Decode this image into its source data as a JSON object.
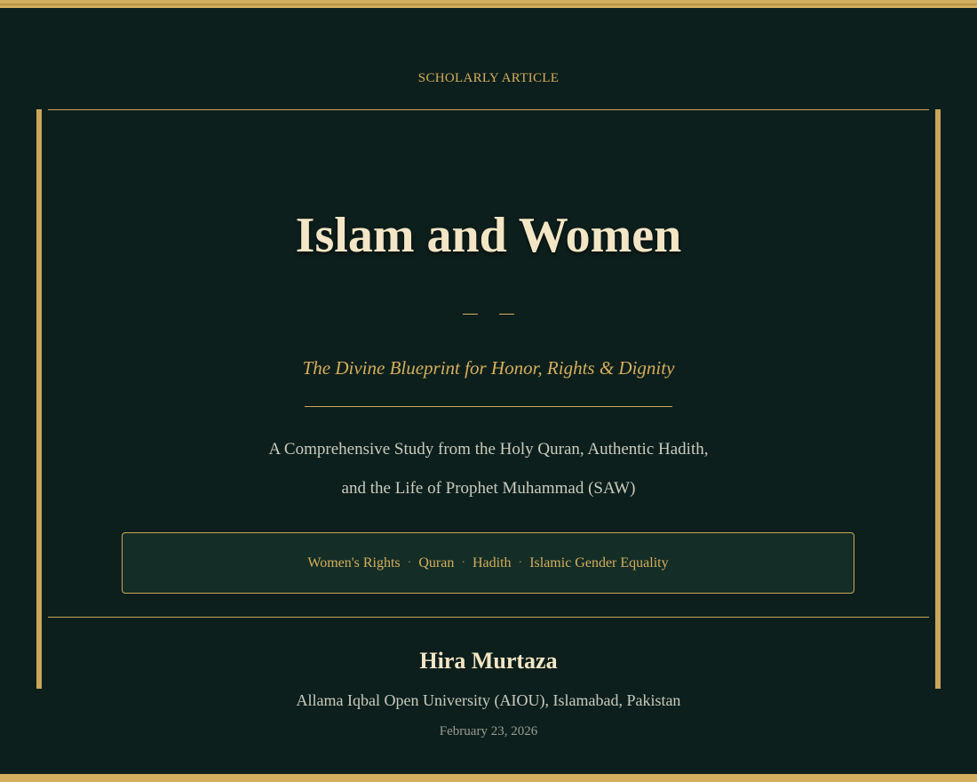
{
  "header": {
    "eyebrow": "SCHOLARLY ARTICLE"
  },
  "article": {
    "title": "Islam and Women",
    "ornament": "— —",
    "subtitle": "The Divine Blueprint for Honor, Rights & Dignity",
    "description_line1": "A Comprehensive Study from the Holy Quran, Authentic Hadith,",
    "description_line2": "and the Life of Prophet Muhammad (SAW)",
    "tags": [
      "Women's Rights",
      "Quran",
      "Hadith",
      "Islamic Gender Equality"
    ],
    "tag_separator": "·"
  },
  "author": {
    "name": "Hira Murtaza",
    "affiliation": "Allama Iqbal Open University (AIOU), Islamabad, Pakistan",
    "date": "February 23, 2026"
  },
  "colors": {
    "background": "#0d1f1c",
    "gold": "#d4ae5c",
    "title": "#f3e6c6",
    "body_text": "#c9cbbf",
    "tag_box": "#142d26"
  }
}
